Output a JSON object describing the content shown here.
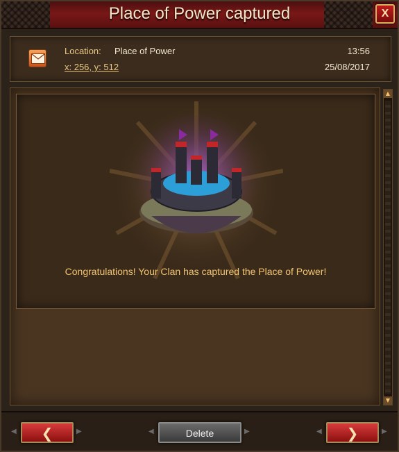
{
  "window": {
    "title": "Place of Power captured",
    "close_label": "X"
  },
  "header": {
    "location_label": "Location:",
    "location_value": "Place of Power",
    "coordinates": "x: 256, y: 512",
    "time": "13:56",
    "date": "25/08/2017",
    "mail_icon": "envelope-icon"
  },
  "message": {
    "text": "Congratulations! Your Clan has captured the Place of Power!",
    "image": "place-of-power-fortress"
  },
  "footer": {
    "prev_glyph": "❮",
    "delete_label": "Delete",
    "next_glyph": "❯"
  },
  "colors": {
    "accent_red": "#8c1010",
    "gold_text": "#f2c473"
  }
}
